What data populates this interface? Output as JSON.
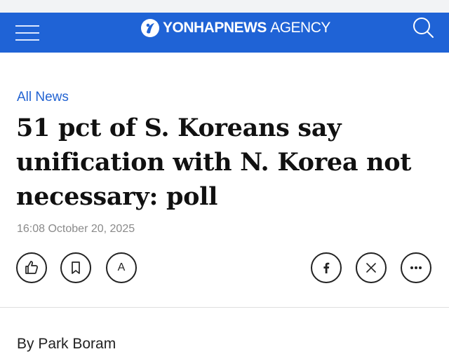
{
  "header": {
    "logo": {
      "brand": "YONHAPNEWS",
      "suffix": "AGENCY"
    },
    "colors": {
      "background": "#1f63d6",
      "text": "#ffffff"
    },
    "icons": {
      "menu": "menu-icon",
      "search": "search-icon"
    }
  },
  "article": {
    "category": "All News",
    "headline": "51 pct of S. Koreans say unification with N. Korea not necessary: poll",
    "timestamp": "16:08 October 20, 2025",
    "byline": "By Park Boram"
  },
  "actions": {
    "left": [
      {
        "name": "like",
        "icon": "thumbs-up-icon"
      },
      {
        "name": "bookmark",
        "icon": "bookmark-icon"
      },
      {
        "name": "font-size",
        "label": "A"
      }
    ],
    "right": [
      {
        "name": "facebook",
        "icon": "facebook-icon"
      },
      {
        "name": "x",
        "icon": "x-icon"
      },
      {
        "name": "more",
        "icon": "more-icon"
      }
    ]
  },
  "accent_color": "#2263d2"
}
